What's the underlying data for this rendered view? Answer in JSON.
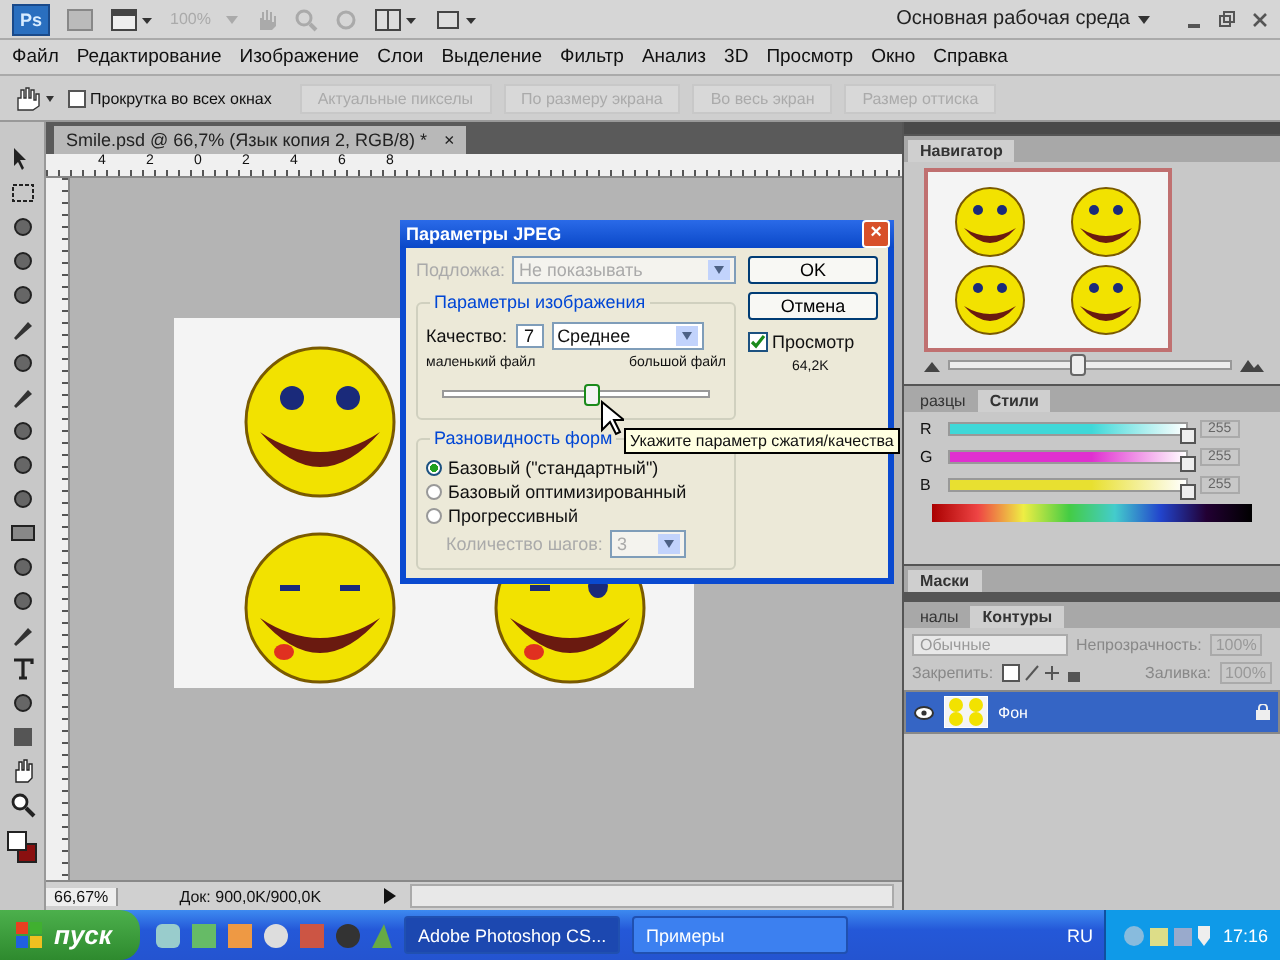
{
  "app_bar": {
    "logo": "Ps",
    "zoom": "100%",
    "workspace": "Основная рабочая среда"
  },
  "menu": [
    "Файл",
    "Редактирование",
    "Изображение",
    "Слои",
    "Выделение",
    "Фильтр",
    "Анализ",
    "3D",
    "Просмотр",
    "Окно",
    "Справка"
  ],
  "options_bar": {
    "scroll_all": {
      "label": "Прокрутка во всех окнах",
      "checked": false
    },
    "buttons": [
      {
        "label": "Актуальные пикселы",
        "disabled": true
      },
      {
        "label": "По размеру экрана",
        "disabled": true
      },
      {
        "label": "Во весь экран",
        "disabled": true
      },
      {
        "label": "Размер оттиска",
        "disabled": true
      }
    ]
  },
  "document": {
    "tab": "Smile.psd @ 66,7% (Язык копия 2, RGB/8) *",
    "close": "×",
    "ruler_labels": [
      "4",
      "2",
      "0",
      "2",
      "4",
      "6",
      "8"
    ],
    "zoom": "66,67%",
    "doc_size": "Док: 900,0K/900,0K"
  },
  "dialog": {
    "title": "Параметры JPEG",
    "close": "×",
    "matte_label": "Подложка:",
    "matte_value": "Не показывать",
    "matte_disabled": true,
    "image_group": "Параметры изображения",
    "quality_label": "Качество:",
    "quality_value": "7",
    "quality_preset": "Среднее",
    "small_file": "маленький файл",
    "large_file": "большой файл",
    "level": 0.55,
    "format_group": "Разновидность форм",
    "formats": [
      {
        "label": "Базовый (\"стандартный\")",
        "selected": true
      },
      {
        "label": "Базовый оптимизированный",
        "selected": false
      },
      {
        "label": "Прогрессивный",
        "selected": false
      }
    ],
    "scans_label": "Количество шагов:",
    "scans_value": "3",
    "scans_disabled": true,
    "ok": "OK",
    "cancel": "Отмена",
    "preview": {
      "label": "Просмотр",
      "checked": true
    },
    "size": "64,2K",
    "tooltip": "Укажите параметр сжатия/качества"
  },
  "navigator": {
    "tab": "Навигатор",
    "level": 0.45
  },
  "color_panel": {
    "tabs": [
      {
        "label": "разцы",
        "selected": false
      },
      {
        "label": "Стили",
        "selected": true
      }
    ],
    "channels": [
      {
        "name": "R",
        "value": "255",
        "level": 1,
        "color": "#40d8d8"
      },
      {
        "name": "G",
        "value": "255",
        "level": 1,
        "color": "#e030d0"
      },
      {
        "name": "B",
        "value": "255",
        "level": 1,
        "color": "#e8e030"
      }
    ]
  },
  "masks_panel": {
    "tab": "Маски"
  },
  "layers_panel": {
    "tabs": [
      {
        "label": "налы",
        "selected": false
      },
      {
        "label": "Контуры",
        "selected": true
      }
    ],
    "blend": "Обычные",
    "opacity_label": "Непрозрачность:",
    "opacity": "100%",
    "lock_label": "Закрепить:",
    "fill_label": "Заливка:",
    "fill": "100%",
    "layers": [
      {
        "name": "Фон",
        "selected": true
      }
    ]
  },
  "taskbar": {
    "start": "пуск",
    "tasks": [
      {
        "label": "Adobe Photoshop CS...",
        "selected": true
      },
      {
        "label": "Примеры",
        "selected": false
      }
    ],
    "lang": "RU",
    "clock": "17:16"
  }
}
